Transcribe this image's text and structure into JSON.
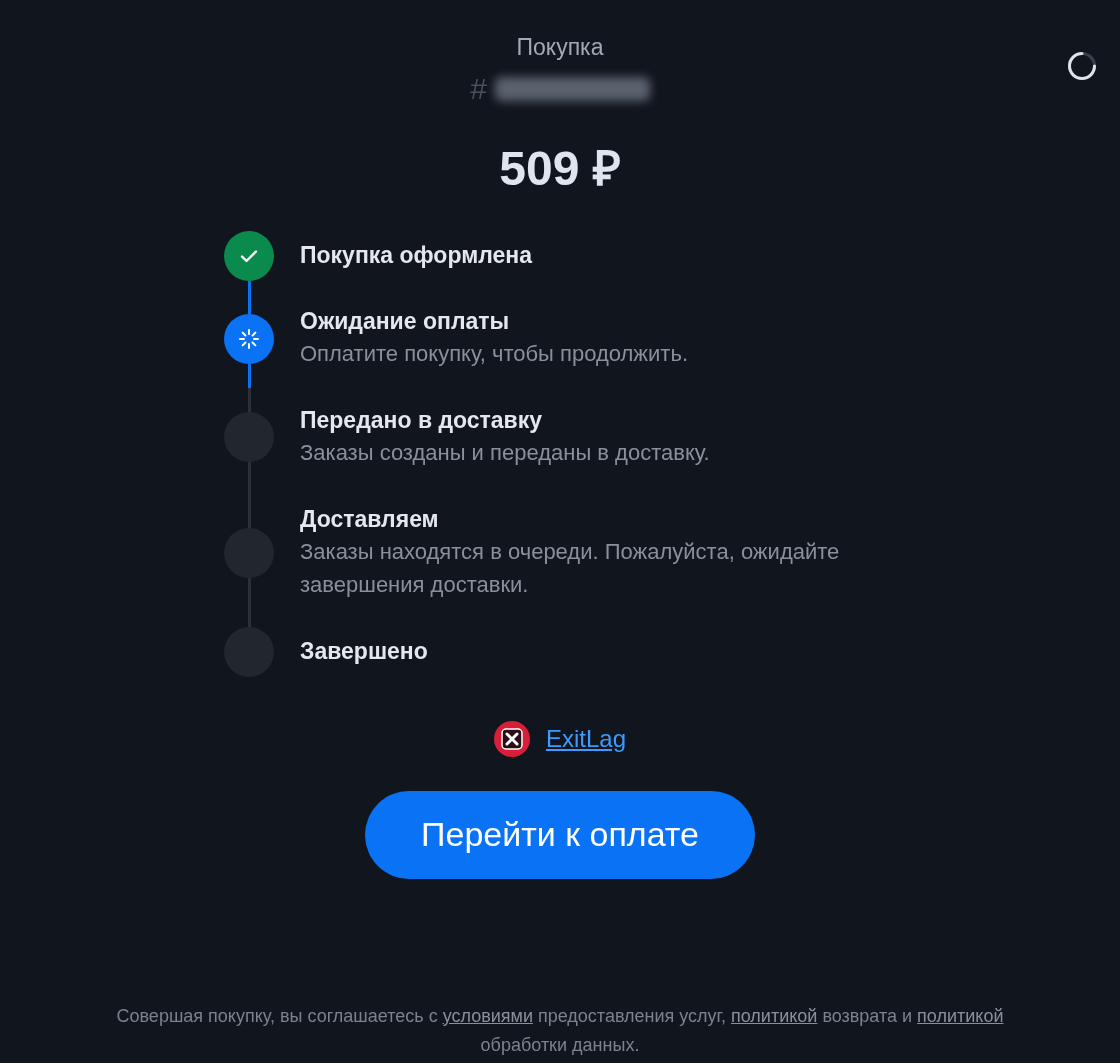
{
  "header": {
    "title": "Покупка",
    "order_prefix": "#",
    "order_hidden": true,
    "price": "509 ₽",
    "loading": true
  },
  "steps": [
    {
      "title": "Покупка оформлена",
      "kind": "done"
    },
    {
      "title": "Ожидание оплаты",
      "description": "Оплатите покупку, чтобы продолжить.",
      "kind": "active"
    },
    {
      "title": "Передано в доставку",
      "description": "Заказы созданы и переданы в доставку.",
      "kind": "pending"
    },
    {
      "title": "Доставляем",
      "description": "Заказы находятся в очереди. Пожалуйста, ожидайте завершения доставки.",
      "kind": "pending"
    },
    {
      "title": "Завершено",
      "kind": "pending"
    }
  ],
  "product": {
    "name": "ExitLag"
  },
  "pay_button": "Перейти к оплате",
  "footer": [
    {
      "kind": "text",
      "text": "Совершая покупку, вы соглашаетесь с "
    },
    {
      "kind": "link",
      "text": "условиями"
    },
    {
      "kind": "text",
      "text": " предоставления услуг, "
    },
    {
      "kind": "link",
      "text": "политикой"
    },
    {
      "kind": "text",
      "text": " возврата и "
    },
    {
      "kind": "link",
      "text": "политикой"
    },
    {
      "kind": "text",
      "text": " обработки данных."
    }
  ]
}
